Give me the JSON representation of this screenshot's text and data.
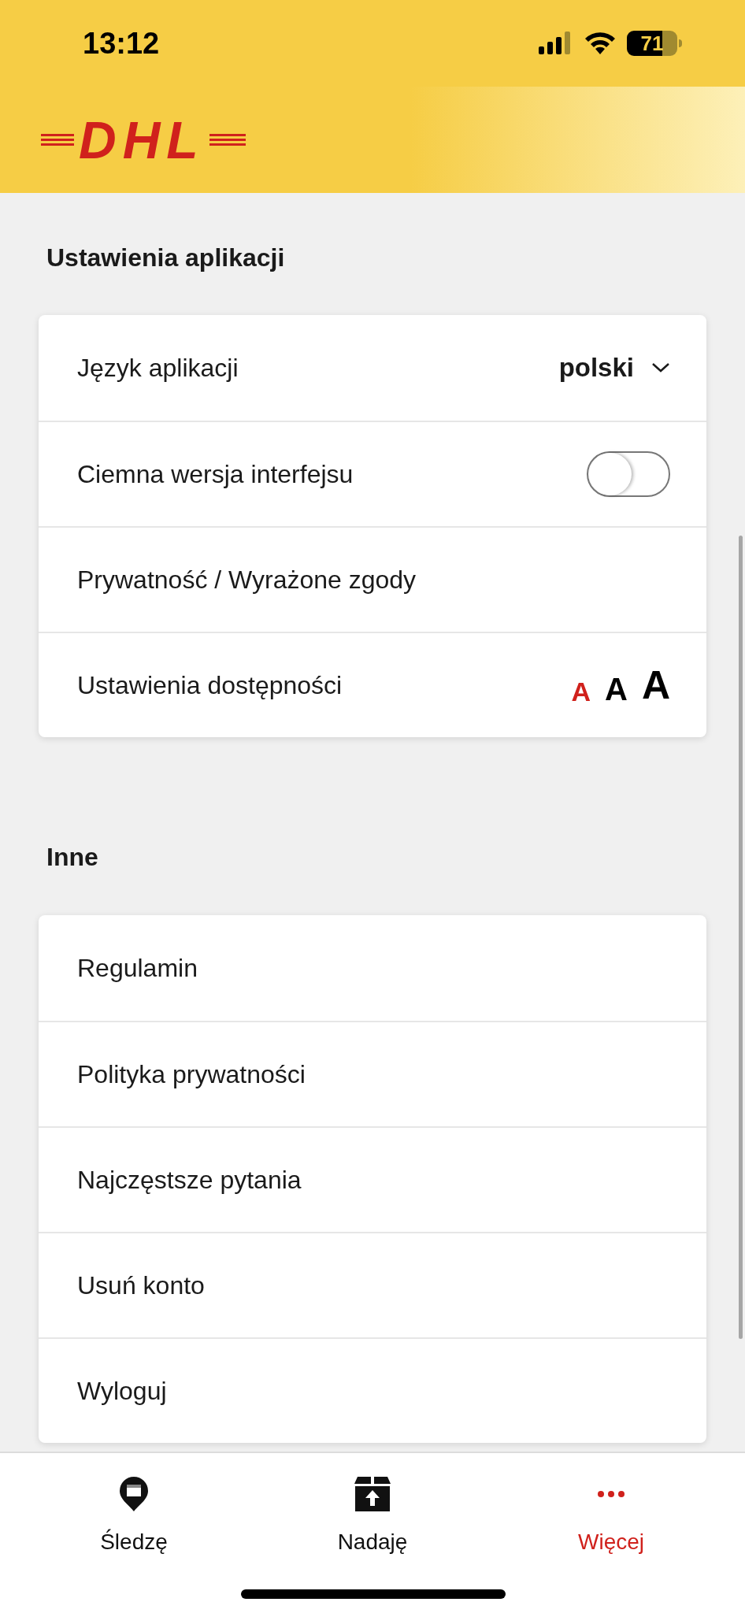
{
  "status_bar": {
    "time": "13:12",
    "battery": "71"
  },
  "header": {
    "logo": "DHL"
  },
  "sections": [
    {
      "title": "Ustawienia aplikacji",
      "rows": [
        {
          "kind": "dropdown",
          "label": "Język aplikacji",
          "value": "polski"
        },
        {
          "kind": "toggle",
          "label": "Ciemna wersja interfejsu",
          "on": false
        },
        {
          "kind": "link",
          "label": "Prywatność / Wyrażone zgody"
        },
        {
          "kind": "text_size",
          "label": "Ustawienia dostępności",
          "options": [
            {
              "label": "A",
              "selected": true
            },
            {
              "label": "A",
              "selected": false
            },
            {
              "label": "A",
              "selected": false
            }
          ]
        }
      ]
    },
    {
      "title": "Inne",
      "rows": [
        {
          "kind": "link",
          "label": "Regulamin"
        },
        {
          "kind": "link",
          "label": "Polityka prywatności"
        },
        {
          "kind": "link",
          "label": "Najczęstsze pytania"
        },
        {
          "kind": "link",
          "label": "Usuń konto"
        },
        {
          "kind": "link",
          "label": "Wyloguj"
        }
      ]
    }
  ],
  "tab_bar": [
    {
      "kind": "track",
      "label": "Śledzę",
      "selected": false
    },
    {
      "kind": "send",
      "label": "Nadaję",
      "selected": false
    },
    {
      "kind": "more",
      "label": "Więcej",
      "selected": true
    }
  ]
}
